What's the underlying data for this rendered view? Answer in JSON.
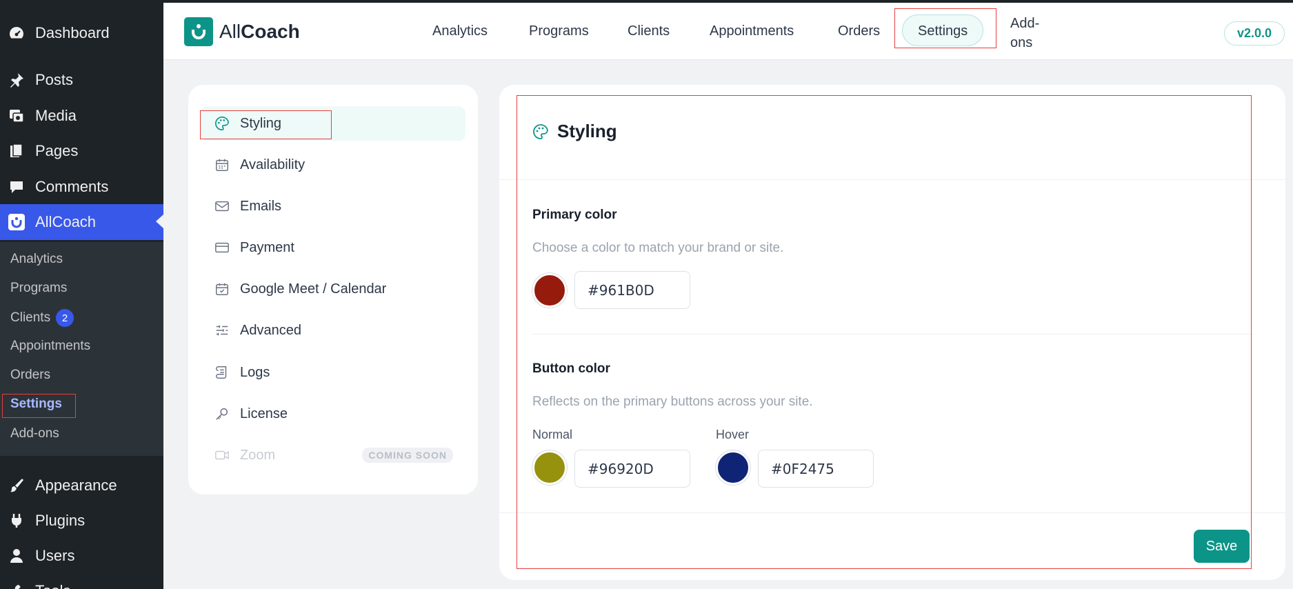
{
  "wp_sidebar": {
    "items": [
      {
        "label": "Dashboard",
        "icon": "dashboard-icon"
      },
      {
        "label": "Posts",
        "icon": "pin-icon"
      },
      {
        "label": "Media",
        "icon": "media-icon"
      },
      {
        "label": "Pages",
        "icon": "pages-icon"
      },
      {
        "label": "Comments",
        "icon": "comment-icon"
      },
      {
        "label": "AllCoach",
        "icon": "allcoach-icon"
      }
    ],
    "submenu": [
      {
        "label": "Analytics"
      },
      {
        "label": "Programs"
      },
      {
        "label": "Clients",
        "badge": "2"
      },
      {
        "label": "Appointments"
      },
      {
        "label": "Orders"
      },
      {
        "label": "Settings"
      },
      {
        "label": "Add-ons"
      }
    ],
    "lower_items": [
      {
        "label": "Appearance",
        "icon": "brush-icon"
      },
      {
        "label": "Plugins",
        "icon": "plug-icon"
      },
      {
        "label": "Users",
        "icon": "user-icon"
      },
      {
        "label": "Tools",
        "icon": "wrench-icon"
      }
    ]
  },
  "header": {
    "logo_light": "All",
    "logo_bold": "Coach",
    "nav": [
      "Analytics",
      "Programs",
      "Clients",
      "Appointments",
      "Orders",
      "Settings"
    ],
    "nav_addons_line1": "Add-",
    "nav_addons_line2": "ons",
    "active_nav": "Settings",
    "version": "v2.0.0"
  },
  "settings_menu": {
    "items": [
      {
        "label": "Styling",
        "icon": "palette-icon"
      },
      {
        "label": "Availability",
        "icon": "calendar-icon"
      },
      {
        "label": "Emails",
        "icon": "mail-icon"
      },
      {
        "label": "Payment",
        "icon": "card-icon"
      },
      {
        "label": "Google Meet / Calendar",
        "icon": "calendar-check-icon"
      },
      {
        "label": "Advanced",
        "icon": "sliders-icon"
      },
      {
        "label": "Logs",
        "icon": "scroll-icon"
      },
      {
        "label": "License",
        "icon": "key-icon"
      },
      {
        "label": "Zoom",
        "icon": "video-icon",
        "tag": "COMING SOON"
      }
    ]
  },
  "panel": {
    "title": "Styling",
    "primary": {
      "title": "Primary color",
      "description": "Choose a color to match your brand or site.",
      "value": "#961B0D"
    },
    "button": {
      "title": "Button color",
      "description": "Reflects on the primary buttons across your site.",
      "normal_label": "Normal",
      "normal_value": "#96920D",
      "hover_label": "Hover",
      "hover_value": "#0F2475"
    },
    "save_label": "Save"
  },
  "colors": {
    "accent": "#0d9488",
    "wp_active": "#3858e9",
    "primary_swatch": "#961B0D",
    "normal_swatch": "#96920D",
    "hover_swatch": "#0F2475"
  }
}
